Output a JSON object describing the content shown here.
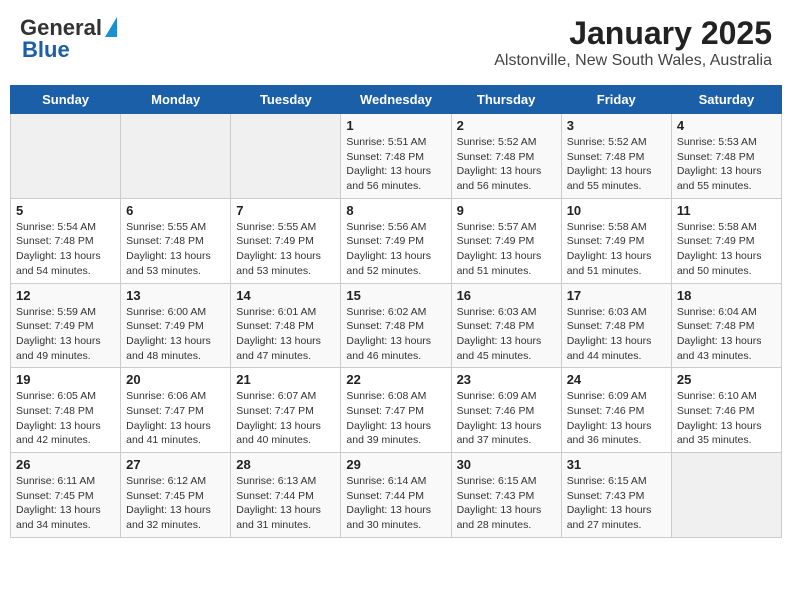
{
  "header": {
    "logo_general": "General",
    "logo_blue": "Blue",
    "title": "January 2025",
    "subtitle": "Alstonville, New South Wales, Australia"
  },
  "weekdays": [
    "Sunday",
    "Monday",
    "Tuesday",
    "Wednesday",
    "Thursday",
    "Friday",
    "Saturday"
  ],
  "weeks": [
    [
      {
        "day": "",
        "info": ""
      },
      {
        "day": "",
        "info": ""
      },
      {
        "day": "",
        "info": ""
      },
      {
        "day": "1",
        "info": "Sunrise: 5:51 AM\nSunset: 7:48 PM\nDaylight: 13 hours\nand 56 minutes."
      },
      {
        "day": "2",
        "info": "Sunrise: 5:52 AM\nSunset: 7:48 PM\nDaylight: 13 hours\nand 56 minutes."
      },
      {
        "day": "3",
        "info": "Sunrise: 5:52 AM\nSunset: 7:48 PM\nDaylight: 13 hours\nand 55 minutes."
      },
      {
        "day": "4",
        "info": "Sunrise: 5:53 AM\nSunset: 7:48 PM\nDaylight: 13 hours\nand 55 minutes."
      }
    ],
    [
      {
        "day": "5",
        "info": "Sunrise: 5:54 AM\nSunset: 7:48 PM\nDaylight: 13 hours\nand 54 minutes."
      },
      {
        "day": "6",
        "info": "Sunrise: 5:55 AM\nSunset: 7:48 PM\nDaylight: 13 hours\nand 53 minutes."
      },
      {
        "day": "7",
        "info": "Sunrise: 5:55 AM\nSunset: 7:49 PM\nDaylight: 13 hours\nand 53 minutes."
      },
      {
        "day": "8",
        "info": "Sunrise: 5:56 AM\nSunset: 7:49 PM\nDaylight: 13 hours\nand 52 minutes."
      },
      {
        "day": "9",
        "info": "Sunrise: 5:57 AM\nSunset: 7:49 PM\nDaylight: 13 hours\nand 51 minutes."
      },
      {
        "day": "10",
        "info": "Sunrise: 5:58 AM\nSunset: 7:49 PM\nDaylight: 13 hours\nand 51 minutes."
      },
      {
        "day": "11",
        "info": "Sunrise: 5:58 AM\nSunset: 7:49 PM\nDaylight: 13 hours\nand 50 minutes."
      }
    ],
    [
      {
        "day": "12",
        "info": "Sunrise: 5:59 AM\nSunset: 7:49 PM\nDaylight: 13 hours\nand 49 minutes."
      },
      {
        "day": "13",
        "info": "Sunrise: 6:00 AM\nSunset: 7:49 PM\nDaylight: 13 hours\nand 48 minutes."
      },
      {
        "day": "14",
        "info": "Sunrise: 6:01 AM\nSunset: 7:48 PM\nDaylight: 13 hours\nand 47 minutes."
      },
      {
        "day": "15",
        "info": "Sunrise: 6:02 AM\nSunset: 7:48 PM\nDaylight: 13 hours\nand 46 minutes."
      },
      {
        "day": "16",
        "info": "Sunrise: 6:03 AM\nSunset: 7:48 PM\nDaylight: 13 hours\nand 45 minutes."
      },
      {
        "day": "17",
        "info": "Sunrise: 6:03 AM\nSunset: 7:48 PM\nDaylight: 13 hours\nand 44 minutes."
      },
      {
        "day": "18",
        "info": "Sunrise: 6:04 AM\nSunset: 7:48 PM\nDaylight: 13 hours\nand 43 minutes."
      }
    ],
    [
      {
        "day": "19",
        "info": "Sunrise: 6:05 AM\nSunset: 7:48 PM\nDaylight: 13 hours\nand 42 minutes."
      },
      {
        "day": "20",
        "info": "Sunrise: 6:06 AM\nSunset: 7:47 PM\nDaylight: 13 hours\nand 41 minutes."
      },
      {
        "day": "21",
        "info": "Sunrise: 6:07 AM\nSunset: 7:47 PM\nDaylight: 13 hours\nand 40 minutes."
      },
      {
        "day": "22",
        "info": "Sunrise: 6:08 AM\nSunset: 7:47 PM\nDaylight: 13 hours\nand 39 minutes."
      },
      {
        "day": "23",
        "info": "Sunrise: 6:09 AM\nSunset: 7:46 PM\nDaylight: 13 hours\nand 37 minutes."
      },
      {
        "day": "24",
        "info": "Sunrise: 6:09 AM\nSunset: 7:46 PM\nDaylight: 13 hours\nand 36 minutes."
      },
      {
        "day": "25",
        "info": "Sunrise: 6:10 AM\nSunset: 7:46 PM\nDaylight: 13 hours\nand 35 minutes."
      }
    ],
    [
      {
        "day": "26",
        "info": "Sunrise: 6:11 AM\nSunset: 7:45 PM\nDaylight: 13 hours\nand 34 minutes."
      },
      {
        "day": "27",
        "info": "Sunrise: 6:12 AM\nSunset: 7:45 PM\nDaylight: 13 hours\nand 32 minutes."
      },
      {
        "day": "28",
        "info": "Sunrise: 6:13 AM\nSunset: 7:44 PM\nDaylight: 13 hours\nand 31 minutes."
      },
      {
        "day": "29",
        "info": "Sunrise: 6:14 AM\nSunset: 7:44 PM\nDaylight: 13 hours\nand 30 minutes."
      },
      {
        "day": "30",
        "info": "Sunrise: 6:15 AM\nSunset: 7:43 PM\nDaylight: 13 hours\nand 28 minutes."
      },
      {
        "day": "31",
        "info": "Sunrise: 6:15 AM\nSunset: 7:43 PM\nDaylight: 13 hours\nand 27 minutes."
      },
      {
        "day": "",
        "info": ""
      }
    ]
  ]
}
